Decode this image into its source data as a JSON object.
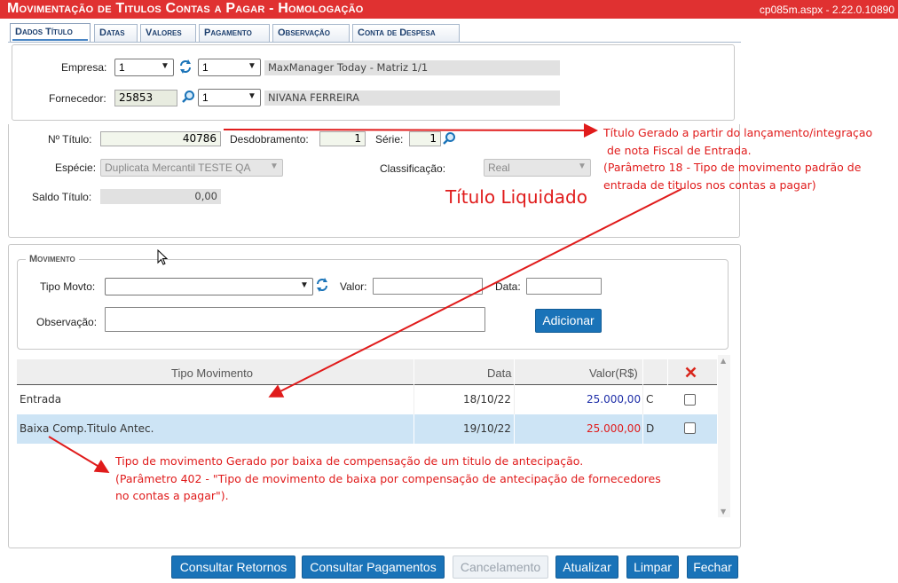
{
  "window": {
    "title": "Movimentação de Titulos Contas a Pagar  - Homologação",
    "version": "cp085m.aspx - 2.22.0.10890"
  },
  "tabs": [
    {
      "label": "Dados Título",
      "active": true
    },
    {
      "label": "Datas"
    },
    {
      "label": "Valores"
    },
    {
      "label": "Pagamento"
    },
    {
      "label": "Observação"
    },
    {
      "label": "Conta de Despesa"
    }
  ],
  "header": {
    "empresa_label": "Empresa:",
    "empresa_value": "1",
    "empresa_filial": "1",
    "empresa_name": "MaxManager Today - Matriz 1/1",
    "fornecedor_label": "Fornecedor:",
    "fornecedor_code": "25853",
    "fornecedor_filial": "1",
    "fornecedor_name": "NIVANA FERREIRA"
  },
  "titulo": {
    "numero_label": "Nº Título:",
    "numero": "40786",
    "desdobramento_label": "Desdobramento:",
    "desdobramento": "1",
    "serie_label": "Série:",
    "serie": "1",
    "especie_label": "Espécie:",
    "especie": "Duplicata Mercantil TESTE QA",
    "classificacao_label": "Classificação:",
    "classificacao": "Real",
    "saldo_label": "Saldo Título:",
    "saldo": "0,00",
    "status": "Título Liquidado"
  },
  "movimento": {
    "legend": "Movimento",
    "tipo_label": "Tipo Movto:",
    "tipo_value": "",
    "valor_label": "Valor:",
    "valor_value": "",
    "data_label": "Data:",
    "data_value": "",
    "obs_label": "Observação:",
    "obs_value": "",
    "add_button": "Adicionar"
  },
  "grid": {
    "columns": [
      "Tipo Movimento",
      "Data",
      "Valor(R$)"
    ],
    "rows": [
      {
        "tipo": "Entrada",
        "data": "18/10/22",
        "valor": "25.000,00",
        "dc": "C",
        "valor_color": "#1f2fa8"
      },
      {
        "tipo": "Baixa Comp.Titulo Antec.",
        "data": "19/10/22",
        "valor": "25.000,00",
        "dc": "D",
        "valor_color": "#e01b1b",
        "selected": true
      }
    ]
  },
  "annotations": {
    "note1": [
      "Título Gerado a partir do lançamento/integraçao",
      "de nota Fiscal de Entrada.",
      "(Parâmetro 18 - Tipo de movimento padrão de",
      "entrada de titulos nos contas a pagar)"
    ],
    "note2": [
      "Tipo de movimento Gerado por baixa de compensação de um titulo de antecipação.",
      "(Parâmetro 402 - \"Tipo de movimento de baixa por compensação de antecipação de fornecedores",
      "no contas a pagar\")."
    ]
  },
  "buttons": {
    "consultar_retornos": "Consultar Retornos",
    "consultar_pagamentos": "Consultar Pagamentos",
    "cancelamento": "Cancelamento",
    "atualizar": "Atualizar",
    "limpar": "Limpar",
    "fechar": "Fechar"
  },
  "colors": {
    "title_bar": "#e03131",
    "button": "#1a73b8",
    "selected_row": "#cde4f5",
    "annotation": "#e01b1b"
  }
}
